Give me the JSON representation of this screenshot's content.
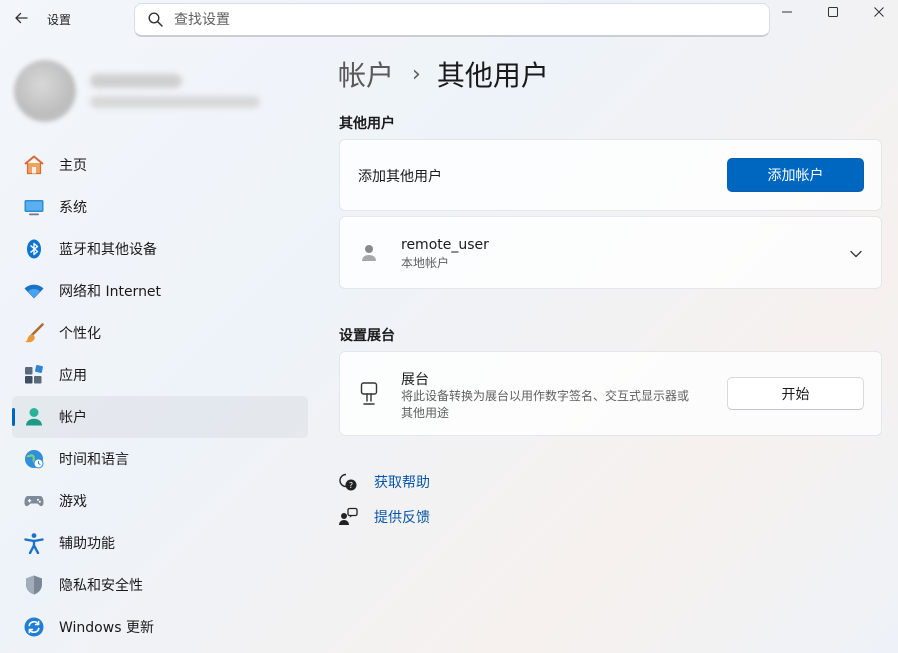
{
  "window": {
    "app_title": "设置",
    "search_placeholder": "查找设置"
  },
  "sidebar": {
    "items": [
      {
        "label": "主页",
        "icon": "home-icon"
      },
      {
        "label": "系统",
        "icon": "monitor-icon"
      },
      {
        "label": "蓝牙和其他设备",
        "icon": "bluetooth-icon"
      },
      {
        "label": "网络和 Internet",
        "icon": "wifi-icon"
      },
      {
        "label": "个性化",
        "icon": "brush-icon"
      },
      {
        "label": "应用",
        "icon": "apps-icon"
      },
      {
        "label": "帐户",
        "icon": "account-icon",
        "active": true
      },
      {
        "label": "时间和语言",
        "icon": "globe-clock-icon"
      },
      {
        "label": "游戏",
        "icon": "gamepad-icon"
      },
      {
        "label": "辅助功能",
        "icon": "accessibility-icon"
      },
      {
        "label": "隐私和安全性",
        "icon": "shield-icon"
      },
      {
        "label": "Windows 更新",
        "icon": "update-icon"
      }
    ]
  },
  "main": {
    "breadcrumb": {
      "parent": "帐户",
      "separator": "›",
      "current": "其他用户"
    },
    "other_users": {
      "section_title": "其他用户",
      "add_label": "添加其他用户",
      "add_button": "添加帐户",
      "user": {
        "name": "remote_user",
        "type": "本地帐户"
      }
    },
    "kiosk": {
      "section_title": "设置展台",
      "title": "展台",
      "description_line1": "将此设备转换为展台以用作数字签名、交互式显示器或",
      "description_line2": "其他用途",
      "button": "开始"
    },
    "links": {
      "help": "获取帮助",
      "feedback": "提供反馈"
    }
  },
  "colors": {
    "accent": "#0067c0",
    "link": "#0a56a8"
  }
}
